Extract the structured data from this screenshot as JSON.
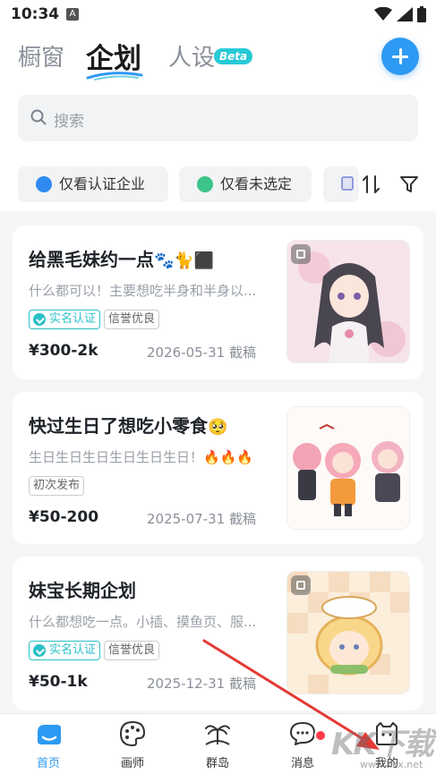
{
  "status_bar": {
    "time": "10:34",
    "notification_badge": "A"
  },
  "header": {
    "tabs": [
      "橱窗",
      "企划",
      "人设"
    ],
    "active_tab": "企划",
    "beta_badge": "Beta",
    "accent_color": "#2d9af3"
  },
  "search": {
    "placeholder": "搜索"
  },
  "filters": {
    "chips": [
      "仅看认证企业",
      "仅看未选定"
    ],
    "sort_icon": "sort-arrows-icon",
    "filter_icon": "funnel-icon"
  },
  "cards": [
    {
      "title": "给黑毛妹约一点",
      "title_emoji": "🐾🐈⬛",
      "description": "什么都可以！主要想吃半身和半身以...",
      "tags": [
        "实名认证",
        "信誉优良"
      ],
      "price": "¥300-2k",
      "deadline": "2026-05-31 截稿"
    },
    {
      "title": "快过生日了想吃小零食",
      "title_emoji": "🥺",
      "description": "生日生日生日生日生日生日！🔥🔥🔥",
      "tags": [
        "初次发布"
      ],
      "price": "¥50-200",
      "deadline": "2025-07-31 截稿"
    },
    {
      "title": "妹宝长期企划",
      "title_emoji": "",
      "description": "什么都想吃一点。小插、摸鱼页、服...",
      "tags": [
        "实名认证",
        "信誉优良"
      ],
      "price": "¥50-1k",
      "deadline": "2025-12-31 截稿"
    }
  ],
  "bottom_nav": {
    "items": [
      "首页",
      "画师",
      "群岛",
      "消息",
      "我的"
    ],
    "active": "首页"
  },
  "watermark": {
    "main": "KK下载",
    "sub": "www.kkx.net"
  }
}
